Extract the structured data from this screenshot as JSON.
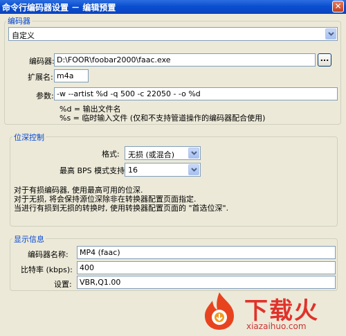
{
  "window": {
    "title": "命令行编码器设置 － 编辑预置",
    "close_glyph": "✕"
  },
  "encoder_group": {
    "legend": "编码器",
    "preset": "自定义",
    "encoder_label": "编码器:",
    "encoder_path": "D:\\FOOR\\foobar2000\\faac.exe",
    "browse_label": "...",
    "ext_label": "扩展名:",
    "ext_value": "m4a",
    "params_label": "参数:",
    "params_value": "-w --artist %d -q 500 -c 22050 - -o %d",
    "hint1": "%d = 输出文件名",
    "hint2": "%s = 临时输入文件 (仅和不支持管道操作的编码器配合使用)"
  },
  "depth_group": {
    "legend": "位深控制",
    "format_label": "格式:",
    "format_value": "无损 (或混合)",
    "bps_label": "最高 BPS 模式支持:",
    "bps_value": "16",
    "note1": "对于有损编码器, 使用最高可用的位深.",
    "note2": "对于无损, 将会保持源位深除非在转换器配置页面指定.",
    "note3": "当进行有损到无损的转换时, 使用转换器配置页面的 \"首选位深\"."
  },
  "display_group": {
    "legend": "显示信息",
    "name_label": "编码器名称:",
    "name_value": "MP4 (faac)",
    "bitrate_label": "比特率 (kbps):",
    "bitrate_value": "400",
    "settings_label": "设置:",
    "settings_value": "VBR,Q1.00"
  },
  "watermark": {
    "brand": "下载火",
    "url": "xiazaihuo.com"
  },
  "colors": {
    "titlebar": "#0a4fd1",
    "legend": "#0046d5",
    "field_border": "#7f9db9",
    "watermark": "#e0322b"
  },
  "icons": {
    "combo_arrow": "chevron-down-icon",
    "close": "close-icon",
    "watermark_logo": "flame-logo-icon"
  }
}
